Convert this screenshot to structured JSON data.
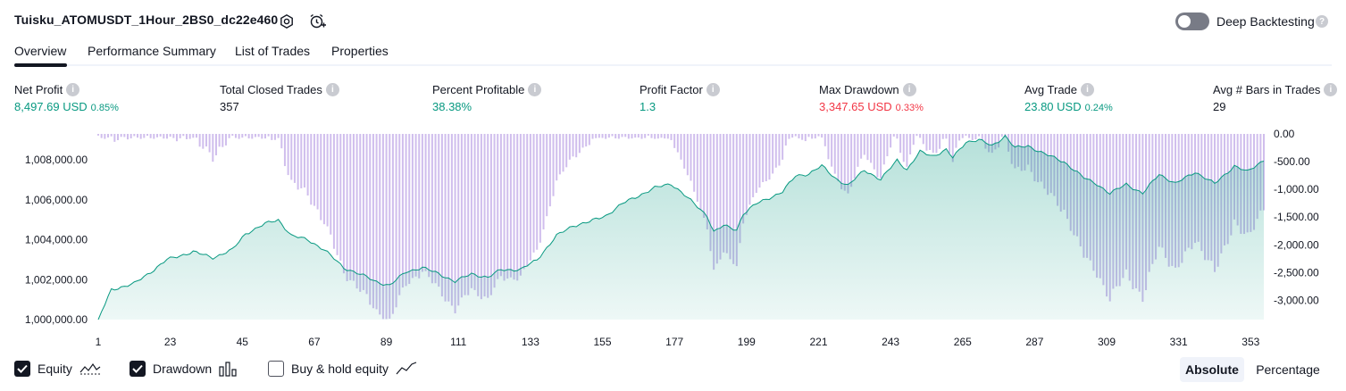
{
  "header": {
    "strategy_title": "Tuisku_ATOMUSDT_1Hour_2BS0_dc22e460",
    "icons": [
      "settings-icon",
      "alert-add-icon"
    ],
    "deep_backtesting_label": "Deep Backtesting",
    "deep_backtesting_enabled": false
  },
  "tabs": [
    {
      "label": "Overview",
      "active": true
    },
    {
      "label": "Performance Summary",
      "active": false
    },
    {
      "label": "List of Trades",
      "active": false
    },
    {
      "label": "Properties",
      "active": false
    }
  ],
  "metrics": [
    {
      "label": "Net Profit",
      "value": "8,497.69 USD",
      "pct": "0.85%",
      "color": "#089981"
    },
    {
      "label": "Total Closed Trades",
      "value": "357",
      "pct": "",
      "color": "#131722"
    },
    {
      "label": "Percent Profitable",
      "value": "38.38%",
      "pct": "",
      "color": "#089981"
    },
    {
      "label": "Profit Factor",
      "value": "1.3",
      "pct": "",
      "color": "#089981"
    },
    {
      "label": "Max Drawdown",
      "value": "3,347.65 USD",
      "pct": "0.33%",
      "color": "#f23645"
    },
    {
      "label": "Avg Trade",
      "value": "23.80 USD",
      "pct": "0.24%",
      "color": "#089981"
    },
    {
      "label": "Avg # Bars in Trades",
      "value": "29",
      "pct": "",
      "color": "#131722"
    }
  ],
  "chart_data": {
    "type": "area",
    "x_ticks": [
      "1",
      "23",
      "45",
      "67",
      "89",
      "111",
      "133",
      "155",
      "177",
      "199",
      "221",
      "243",
      "265",
      "287",
      "309",
      "331",
      "353"
    ],
    "x_range": [
      1,
      357
    ],
    "left_axis": {
      "ticks": [
        "1,000,000.00",
        "1,002,000.00",
        "1,004,000.00",
        "1,006,000.00",
        "1,008,000.00"
      ],
      "range": [
        1000000,
        1009300
      ]
    },
    "right_axis": {
      "ticks": [
        "0.00",
        "-500.00",
        "-1,000.00",
        "-1,500.00",
        "-2,000.00",
        "-2,500.00",
        "-3,000.00"
      ],
      "range": [
        -3347.65,
        0
      ]
    },
    "equity_anchors": [
      [
        1,
        1000000
      ],
      [
        5,
        1001500
      ],
      [
        12,
        1001800
      ],
      [
        18,
        1002500
      ],
      [
        22,
        1003000
      ],
      [
        30,
        1003400
      ],
      [
        36,
        1003100
      ],
      [
        42,
        1003500
      ],
      [
        46,
        1004300
      ],
      [
        52,
        1004800
      ],
      [
        56,
        1005000
      ],
      [
        60,
        1004200
      ],
      [
        65,
        1004000
      ],
      [
        70,
        1003500
      ],
      [
        76,
        1002600
      ],
      [
        82,
        1002200
      ],
      [
        86,
        1001900
      ],
      [
        90,
        1001700
      ],
      [
        95,
        1002400
      ],
      [
        100,
        1002600
      ],
      [
        105,
        1002300
      ],
      [
        110,
        1001900
      ],
      [
        115,
        1002300
      ],
      [
        120,
        1002100
      ],
      [
        124,
        1002500
      ],
      [
        130,
        1002500
      ],
      [
        135,
        1003000
      ],
      [
        141,
        1004200
      ],
      [
        146,
        1004700
      ],
      [
        151,
        1004900
      ],
      [
        156,
        1005200
      ],
      [
        161,
        1005800
      ],
      [
        166,
        1006200
      ],
      [
        171,
        1006600
      ],
      [
        176,
        1006800
      ],
      [
        179,
        1006400
      ],
      [
        183,
        1005800
      ],
      [
        187,
        1005200
      ],
      [
        189,
        1004400
      ],
      [
        192,
        1004700
      ],
      [
        196,
        1004500
      ],
      [
        198,
        1005300
      ],
      [
        202,
        1005800
      ],
      [
        206,
        1006100
      ],
      [
        210,
        1006400
      ],
      [
        214,
        1007200
      ],
      [
        218,
        1007300
      ],
      [
        222,
        1007700
      ],
      [
        226,
        1007100
      ],
      [
        230,
        1006700
      ],
      [
        235,
        1007500
      ],
      [
        240,
        1007000
      ],
      [
        245,
        1008000
      ],
      [
        248,
        1007500
      ],
      [
        252,
        1008400
      ],
      [
        256,
        1008200
      ],
      [
        260,
        1008500
      ],
      [
        262,
        1008100
      ],
      [
        266,
        1008900
      ],
      [
        270,
        1009000
      ],
      [
        274,
        1008700
      ],
      [
        278,
        1009200
      ],
      [
        281,
        1008600
      ],
      [
        285,
        1008700
      ],
      [
        290,
        1008300
      ],
      [
        296,
        1007900
      ],
      [
        302,
        1007100
      ],
      [
        306,
        1006800
      ],
      [
        310,
        1006300
      ],
      [
        315,
        1006800
      ],
      [
        320,
        1006300
      ],
      [
        325,
        1007300
      ],
      [
        330,
        1006800
      ],
      [
        336,
        1007400
      ],
      [
        342,
        1006800
      ],
      [
        348,
        1007700
      ],
      [
        352,
        1007400
      ],
      [
        357,
        1008000
      ]
    ],
    "series": [
      {
        "name": "Equity",
        "visible": true,
        "line_color": "#089981",
        "fill": "area"
      },
      {
        "name": "Drawdown",
        "visible": true,
        "bar_color": "#c8b3ea"
      },
      {
        "name": "Buy & hold equity",
        "visible": false
      }
    ]
  },
  "legend": {
    "equity": {
      "label": "Equity",
      "checked": true
    },
    "drawdown": {
      "label": "Drawdown",
      "checked": true
    },
    "buyhold": {
      "label": "Buy & hold equity",
      "checked": false
    }
  },
  "scale_buttons": {
    "absolute": "Absolute",
    "percentage": "Percentage",
    "selected": "absolute"
  }
}
